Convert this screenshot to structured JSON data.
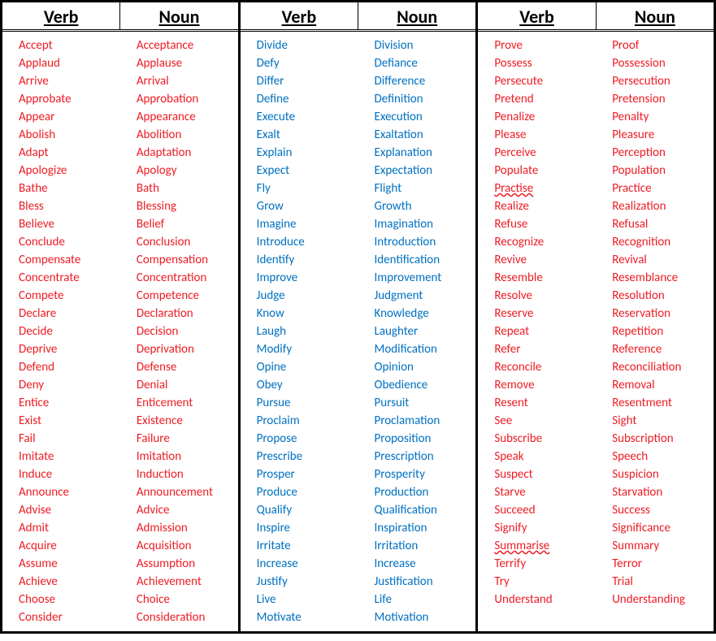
{
  "headers": {
    "verb": "Verb",
    "noun": "Noun"
  },
  "groups": [
    {
      "colorClass": "c-red",
      "rows": [
        {
          "verb": "Accept",
          "noun": "Acceptance"
        },
        {
          "verb": "Applaud",
          "noun": "Applause"
        },
        {
          "verb": "Arrive",
          "noun": "Arrival"
        },
        {
          "verb": "Approbate",
          "noun": "Approbation"
        },
        {
          "verb": "Appear",
          "noun": "Appearance"
        },
        {
          "verb": "Abolish",
          "noun": "Abolition"
        },
        {
          "verb": "Adapt",
          "noun": "Adaptation"
        },
        {
          "verb": "Apologize",
          "noun": "Apology"
        },
        {
          "verb": "Bathe",
          "noun": "Bath"
        },
        {
          "verb": "Bless",
          "noun": "Blessing"
        },
        {
          "verb": "Believe",
          "noun": "Belief"
        },
        {
          "verb": "Conclude",
          "noun": "Conclusion"
        },
        {
          "verb": "Compensate",
          "noun": "Compensation"
        },
        {
          "verb": "Concentrate",
          "noun": "Concentration"
        },
        {
          "verb": "Compete",
          "noun": "Competence"
        },
        {
          "verb": "Declare",
          "noun": "Declaration"
        },
        {
          "verb": "Decide",
          "noun": "Decision"
        },
        {
          "verb": "Deprive",
          "noun": "Deprivation"
        },
        {
          "verb": "Defend",
          "noun": "Defense"
        },
        {
          "verb": "Deny",
          "noun": "Denial"
        },
        {
          "verb": "Entice",
          "noun": "Enticement"
        },
        {
          "verb": "Exist",
          "noun": "Existence"
        },
        {
          "verb": "Fail",
          "noun": "Failure"
        },
        {
          "verb": "Imitate",
          "noun": "Imitation"
        },
        {
          "verb": "Induce",
          "noun": "Induction"
        },
        {
          "verb": "Announce",
          "noun": "Announcement"
        },
        {
          "verb": "Advise",
          "noun": "Advice"
        },
        {
          "verb": "Admit",
          "noun": "Admission"
        },
        {
          "verb": "Acquire",
          "noun": "Acquisition"
        },
        {
          "verb": "Assume",
          "noun": "Assumption"
        },
        {
          "verb": "Achieve",
          "noun": "Achievement"
        },
        {
          "verb": "Choose",
          "noun": "Choice"
        },
        {
          "verb": "Consider",
          "noun": "Consideration"
        }
      ]
    },
    {
      "colorClass": "c-blue",
      "rows": [
        {
          "verb": "Divide",
          "noun": "Division"
        },
        {
          "verb": "Defy",
          "noun": "Defiance"
        },
        {
          "verb": "Differ",
          "noun": "Difference"
        },
        {
          "verb": "Define",
          "noun": "Definition"
        },
        {
          "verb": "Execute",
          "noun": "Execution"
        },
        {
          "verb": "Exalt",
          "noun": "Exaltation"
        },
        {
          "verb": "Explain",
          "noun": "Explanation"
        },
        {
          "verb": "Expect",
          "noun": "Expectation"
        },
        {
          "verb": "Fly",
          "noun": "Flight"
        },
        {
          "verb": "Grow",
          "noun": "Growth"
        },
        {
          "verb": "Imagine",
          "noun": "Imagination"
        },
        {
          "verb": "Introduce",
          "noun": "Introduction"
        },
        {
          "verb": "Identify",
          "noun": "Identification"
        },
        {
          "verb": "Improve",
          "noun": "Improvement"
        },
        {
          "verb": "Judge",
          "noun": "Judgment"
        },
        {
          "verb": "Know",
          "noun": "Knowledge"
        },
        {
          "verb": "Laugh",
          "noun": "Laughter"
        },
        {
          "verb": "Modify",
          "noun": "Modification"
        },
        {
          "verb": "Opine",
          "noun": "Opinion"
        },
        {
          "verb": "Obey",
          "noun": "Obedience"
        },
        {
          "verb": "Pursue",
          "noun": "Pursuit"
        },
        {
          "verb": "Proclaim",
          "noun": "Proclamation"
        },
        {
          "verb": "Propose",
          "noun": "Proposition"
        },
        {
          "verb": "Prescribe",
          "noun": "Prescription"
        },
        {
          "verb": "Prosper",
          "noun": "Prosperity"
        },
        {
          "verb": "Produce",
          "noun": "Production"
        },
        {
          "verb": "Qualify",
          "noun": "Qualification"
        },
        {
          "verb": "Inspire",
          "noun": "Inspiration"
        },
        {
          "verb": "Irritate",
          "noun": "Irritation"
        },
        {
          "verb": "Increase",
          "noun": "Increase"
        },
        {
          "verb": "Justify",
          "noun": "Justification"
        },
        {
          "verb": "Live",
          "noun": "Life"
        },
        {
          "verb": "Motivate",
          "noun": "Motivation"
        }
      ]
    },
    {
      "colorClass": "c-red",
      "rows": [
        {
          "verb": "Prove",
          "noun": "Proof"
        },
        {
          "verb": "Possess",
          "noun": "Possession"
        },
        {
          "verb": "Persecute",
          "noun": "Persecution"
        },
        {
          "verb": "Pretend",
          "noun": "Pretension"
        },
        {
          "verb": "Penalize",
          "noun": "Penalty"
        },
        {
          "verb": "Please",
          "noun": "Pleasure"
        },
        {
          "verb": "Perceive",
          "noun": "Perception"
        },
        {
          "verb": "Populate",
          "noun": "Population"
        },
        {
          "verb": "Practise",
          "noun": "Practice",
          "verbSquiggle": true
        },
        {
          "verb": "Realize",
          "noun": "Realization"
        },
        {
          "verb": "Refuse",
          "noun": "Refusal"
        },
        {
          "verb": "Recognize",
          "noun": "Recognition"
        },
        {
          "verb": "Revive",
          "noun": "Revival"
        },
        {
          "verb": "Resemble",
          "noun": "Resemblance"
        },
        {
          "verb": "Resolve",
          "noun": "Resolution"
        },
        {
          "verb": "Reserve",
          "noun": "Reservation"
        },
        {
          "verb": "Repeat",
          "noun": "Repetition"
        },
        {
          "verb": "Refer",
          "noun": "Reference"
        },
        {
          "verb": "Reconcile",
          "noun": "Reconciliation"
        },
        {
          "verb": "Remove",
          "noun": "Removal"
        },
        {
          "verb": "Resent",
          "noun": "Resentment"
        },
        {
          "verb": "See",
          "noun": "Sight"
        },
        {
          "verb": "Subscribe",
          "noun": "Subscription"
        },
        {
          "verb": "Speak",
          "noun": "Speech"
        },
        {
          "verb": "Suspect",
          "noun": "Suspicion"
        },
        {
          "verb": "Starve",
          "noun": "Starvation"
        },
        {
          "verb": "Succeed",
          "noun": "Success"
        },
        {
          "verb": "Signify",
          "noun": "Significance"
        },
        {
          "verb": "Summarise",
          "noun": "Summary",
          "verbSquiggle": true
        },
        {
          "verb": "Terrify",
          "noun": "Terror"
        },
        {
          "verb": "Try",
          "noun": "Trial"
        },
        {
          "verb": "Understand",
          "noun": "Understanding"
        }
      ]
    }
  ]
}
